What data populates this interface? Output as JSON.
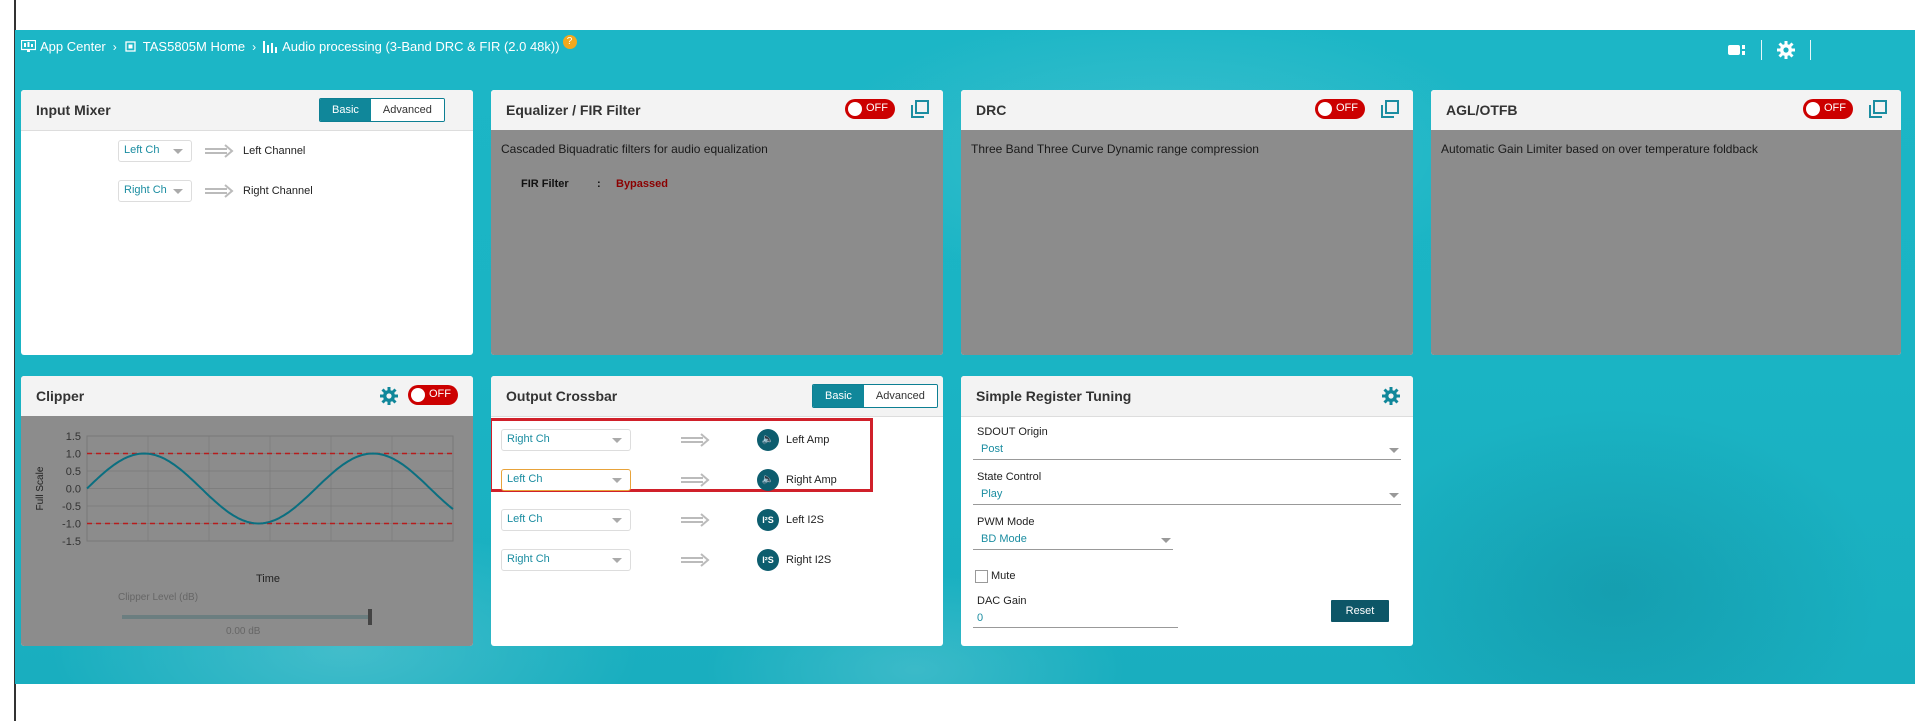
{
  "breadcrumb": {
    "app_center": "App Center",
    "device_home": "TAS5805M Home",
    "current_page": "Audio processing (3-Band DRC & FIR (2.0 48k))",
    "help_badge": "?"
  },
  "icons": {
    "app_center": "monitor-icon",
    "device_home": "chip-icon",
    "audio_processing": "bar-chart-icon",
    "topright_device": "device-icon",
    "topright_settings": "gear-icon"
  },
  "input_mixer": {
    "title": "Input Mixer",
    "mode_basic": "Basic",
    "mode_advanced": "Advanced",
    "rows": [
      {
        "source": "Left Ch",
        "destination": "Left Channel"
      },
      {
        "source": "Right Ch",
        "destination": "Right Channel"
      }
    ]
  },
  "eq": {
    "title": "Equalizer / FIR Filter",
    "toggle": "OFF",
    "description": "Cascaded Biquadratic filters for audio equalization",
    "fir_label": "FIR Filter",
    "fir_sep": ":",
    "fir_status": "Bypassed"
  },
  "drc": {
    "title": "DRC",
    "toggle": "OFF",
    "description": "Three Band Three Curve Dynamic range compression"
  },
  "agl": {
    "title": "AGL/OTFB",
    "toggle": "OFF",
    "description": "Automatic Gain Limiter based on over temperature foldback"
  },
  "clipper": {
    "title": "Clipper",
    "toggle": "OFF",
    "slider_label": "Clipper Level (dB)",
    "slider_value": "0.00 dB",
    "slider_fraction": 1.0
  },
  "chart_data": {
    "type": "line",
    "xlabel": "Time",
    "ylabel": "Full Scale",
    "ylim": [
      -1.5,
      1.5
    ],
    "yticks": [
      1.5,
      1.0,
      0.5,
      0.0,
      -0.5,
      -1.0,
      -1.5
    ],
    "ytick_labels": [
      "1.5",
      "1.0",
      "0.5",
      "0.0",
      "-0.5",
      "-1.0",
      "-1.5"
    ],
    "grid": true,
    "series": [
      {
        "kind": "sine",
        "amplitude": 1.0,
        "cycles": 1.6,
        "color": "#0b6f80"
      }
    ],
    "threshold_lines": [
      1.0,
      -1.0
    ],
    "threshold_color": "#b71c1c"
  },
  "crossbar": {
    "title": "Output Crossbar",
    "mode_basic": "Basic",
    "mode_advanced": "Advanced",
    "rows": [
      {
        "source": "Right Ch",
        "output": "Left Amp",
        "icon": "speaker-icon",
        "glyph": "🔈"
      },
      {
        "source": "Left Ch",
        "output": "Right Amp",
        "icon": "speaker-icon",
        "glyph": "🔈"
      },
      {
        "source": "Left Ch",
        "output": "Left I2S",
        "icon": "i2s-icon",
        "glyph": "I²S"
      },
      {
        "source": "Right Ch",
        "output": "Right I2S",
        "icon": "i2s-icon",
        "glyph": "I²S"
      }
    ]
  },
  "register_tuning": {
    "title": "Simple Register Tuning",
    "sdout_label": "SDOUT Origin",
    "sdout_value": "Post",
    "state_label": "State Control",
    "state_value": "Play",
    "pwm_label": "PWM Mode",
    "pwm_value": "BD Mode",
    "mute_label": "Mute",
    "dac_label": "DAC Gain",
    "dac_value": "0",
    "reset_label": "Reset"
  },
  "colors": {
    "accent": "#10879a",
    "toggle_off": "#cc0000",
    "highlight_box": "#d0202a",
    "background": "#1ab4c4"
  }
}
